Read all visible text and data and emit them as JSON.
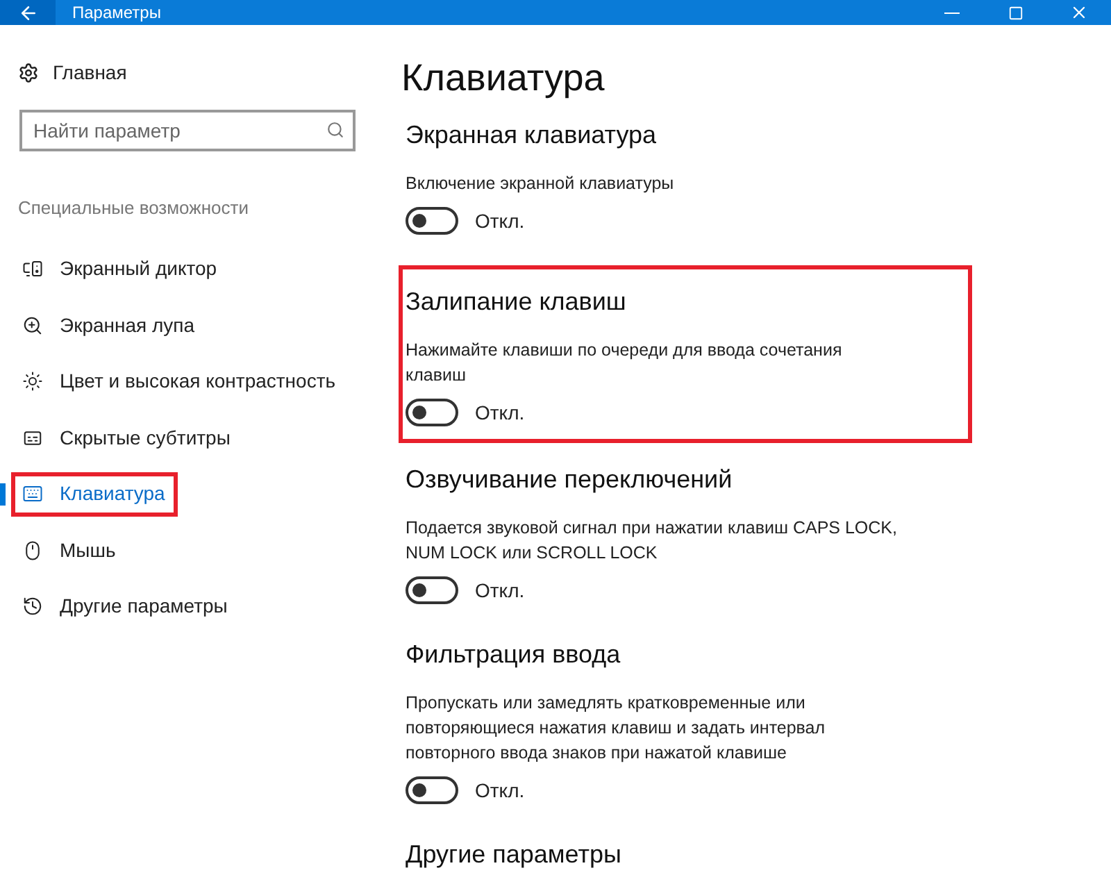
{
  "window": {
    "title": "Параметры"
  },
  "sidebar": {
    "home": "Главная",
    "search": {
      "placeholder": "Найти параметр"
    },
    "category": "Специальные возможности",
    "items": [
      {
        "kind": "narrator",
        "label": "Экранный диктор",
        "selected": false,
        "highlighted": false
      },
      {
        "kind": "magnifier",
        "label": "Экранная лупа",
        "selected": false,
        "highlighted": false
      },
      {
        "kind": "contrast",
        "label": "Цвет и высокая контрастность",
        "selected": false,
        "highlighted": false
      },
      {
        "kind": "captions",
        "label": "Скрытые субтитры",
        "selected": false,
        "highlighted": false
      },
      {
        "kind": "keyboard",
        "label": "Клавиатура",
        "selected": true,
        "highlighted": true
      },
      {
        "kind": "mouse",
        "label": "Мышь",
        "selected": false,
        "highlighted": false
      },
      {
        "kind": "other",
        "label": "Другие параметры",
        "selected": false,
        "highlighted": false
      }
    ]
  },
  "page": {
    "title": "Клавиатура",
    "sections": [
      {
        "heading": "Экранная клавиатура",
        "description": "Включение экранной клавиатуры",
        "toggle": {
          "on": false,
          "label": "Откл."
        },
        "highlighted": false
      },
      {
        "heading": "Залипание клавиш",
        "description": "Нажимайте клавиши по очереди для ввода сочетания клавиш",
        "toggle": {
          "on": false,
          "label": "Откл."
        },
        "highlighted": true
      },
      {
        "heading": "Озвучивание переключений",
        "description": "Подается звуковой сигнал при нажатии клавиш CAPS LOCK, NUM LOCK или SCROLL LOCK",
        "toggle": {
          "on": false,
          "label": "Откл."
        },
        "highlighted": false
      },
      {
        "heading": "Фильтрация ввода",
        "description": "Пропускать или замедлять кратковременные или повторяющиеся нажатия клавиш и задать интервал повторного ввода знаков при нажатой клавише",
        "toggle": {
          "on": false,
          "label": "Откл."
        },
        "highlighted": false
      },
      {
        "heading": "Другие параметры",
        "highlighted": false
      }
    ]
  }
}
